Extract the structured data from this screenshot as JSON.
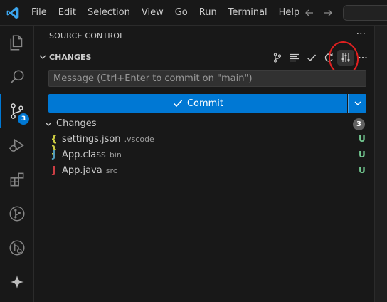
{
  "titlebar": {
    "menu": [
      "File",
      "Edit",
      "Selection",
      "View",
      "Go",
      "Run",
      "Terminal",
      "Help"
    ]
  },
  "activity": {
    "scm_badge": "3"
  },
  "sidebar": {
    "title": "SOURCE CONTROL",
    "more": "···",
    "section_title": "CHANGES",
    "commit_message_placeholder": "Message (Ctrl+Enter to commit on \"main\")",
    "commit_label": "Commit",
    "group_label": "Changes",
    "group_count": "3",
    "files": [
      {
        "icon_glyph": "{ }",
        "icon_color": "#cbcb41",
        "name": "settings.json",
        "dir": ".vscode",
        "status": "U"
      },
      {
        "icon_glyph": "J",
        "icon_color": "#519aba",
        "name": "App.class",
        "dir": "bin",
        "status": "U"
      },
      {
        "icon_glyph": "J",
        "icon_color": "#cc3e44",
        "name": "App.java",
        "dir": "src",
        "status": "U"
      }
    ]
  },
  "colors": {
    "accent": "#0078d4",
    "untracked": "#73c991",
    "annotation": "#e02020"
  }
}
